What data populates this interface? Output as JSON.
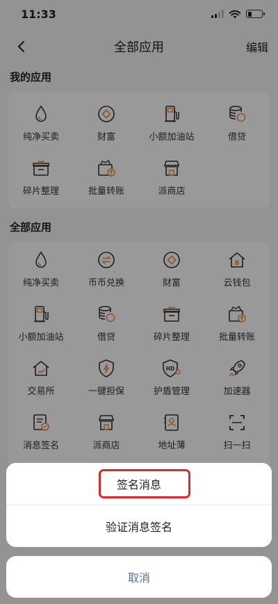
{
  "status_bar": {
    "time": "11:33"
  },
  "nav": {
    "title": "全部应用",
    "edit_label": "编辑"
  },
  "my_apps": {
    "title": "我的应用",
    "items": [
      {
        "label": "纯净买卖",
        "icon": "drop-icon"
      },
      {
        "label": "财富",
        "icon": "diamond-coin-icon"
      },
      {
        "label": "小额加油站",
        "icon": "fuel-pump-icon"
      },
      {
        "label": "借贷",
        "icon": "coin-stack-icon"
      },
      {
        "label": "碎片整理",
        "icon": "box-icon"
      },
      {
        "label": "批量转账",
        "icon": "batch-transfer-icon"
      },
      {
        "label": "派商店",
        "icon": "store-icon"
      }
    ]
  },
  "all_apps": {
    "title": "全部应用",
    "items": [
      {
        "label": "纯净买卖",
        "icon": "drop-icon"
      },
      {
        "label": "币币兑换",
        "icon": "exchange-icon"
      },
      {
        "label": "财富",
        "icon": "diamond-coin-icon"
      },
      {
        "label": "云钱包",
        "icon": "cloud-wallet-icon"
      },
      {
        "label": "小额加油站",
        "icon": "fuel-pump-icon"
      },
      {
        "label": "借贷",
        "icon": "coin-stack-icon"
      },
      {
        "label": "碎片整理",
        "icon": "box-icon"
      },
      {
        "label": "批量转账",
        "icon": "batch-transfer-icon"
      },
      {
        "label": "交易所",
        "icon": "exchange-house-icon"
      },
      {
        "label": "一键担保",
        "icon": "shield-icon"
      },
      {
        "label": "护盾管理",
        "icon": "hd-shield-icon"
      },
      {
        "label": "加速器",
        "icon": "rocket-icon"
      },
      {
        "label": "消息签名",
        "icon": "sign-message-icon"
      },
      {
        "label": "派商店",
        "icon": "store-icon"
      },
      {
        "label": "地址薄",
        "icon": "address-book-icon"
      },
      {
        "label": "扫一扫",
        "icon": "scan-icon"
      }
    ]
  },
  "action_sheet": {
    "options": [
      "签名消息",
      "验证消息签名"
    ],
    "cancel_label": "取消",
    "highlight_color": "#e02828"
  },
  "colors": {
    "accent": "#f08a3c",
    "icon_stroke": "#333333",
    "cancel_text": "#5a6f9c"
  }
}
